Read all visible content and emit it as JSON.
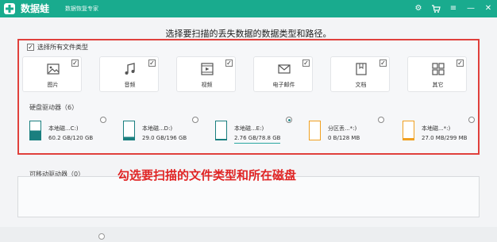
{
  "app": {
    "name": "数据蛙",
    "subtitle": "数据恢复专家",
    "brand_color": "#19ab8e"
  },
  "titlebar": {
    "icons": [
      "settings-icon",
      "cart-icon",
      "menu-icon",
      "minimize-icon",
      "close-icon"
    ],
    "icon_glyphs": [
      "⚙",
      "🛒",
      "≡",
      "—",
      "✕"
    ]
  },
  "instruction": "选择要扫描的丢失数据的数据类型和路径。",
  "select_all": {
    "label": "选择所有文件类型",
    "checked": true
  },
  "file_types": [
    {
      "label": "图片",
      "icon": "image-icon",
      "checked": true
    },
    {
      "label": "音频",
      "icon": "music-icon",
      "checked": true
    },
    {
      "label": "视频",
      "icon": "video-icon",
      "checked": true
    },
    {
      "label": "电子邮件",
      "icon": "email-icon",
      "checked": true
    },
    {
      "label": "文档",
      "icon": "document-icon",
      "checked": true
    },
    {
      "label": "其它",
      "icon": "other-icon",
      "checked": true
    }
  ],
  "hard_disks": {
    "title": "硬盘驱动器（6）",
    "items": [
      {
        "name": "本地磁...C:)",
        "usage": "60.2 GB/120 GB",
        "fill": 0.5,
        "color": "#1a7f7f",
        "selected": false
      },
      {
        "name": "本地磁...D:)",
        "usage": "29.0 GB/196 GB",
        "fill": 0.15,
        "color": "#1a7f7f",
        "selected": false
      },
      {
        "name": "本地磁...E:)",
        "usage": "2.76 GB/78.8 GB",
        "fill": 0.04,
        "color": "#1a7f7f",
        "selected": true
      },
      {
        "name": "分区丢...*:)",
        "usage": "0 B/128 MB",
        "fill": 0.0,
        "color": "#f0a020",
        "selected": false
      },
      {
        "name": "本地磁...*:)",
        "usage": "27.0 MB/299 MB",
        "fill": 0.09,
        "color": "#f0a020",
        "selected": false
      },
      {
        "name": "",
        "usage": "",
        "fill": 0.0,
        "color": "#1a7f7f",
        "selected": false
      }
    ]
  },
  "removable": {
    "title": "可移动驱动器（0）"
  },
  "annotation": "勾选要扫描的文件类型和所在磁盘",
  "highlight_color": "#e0403c"
}
